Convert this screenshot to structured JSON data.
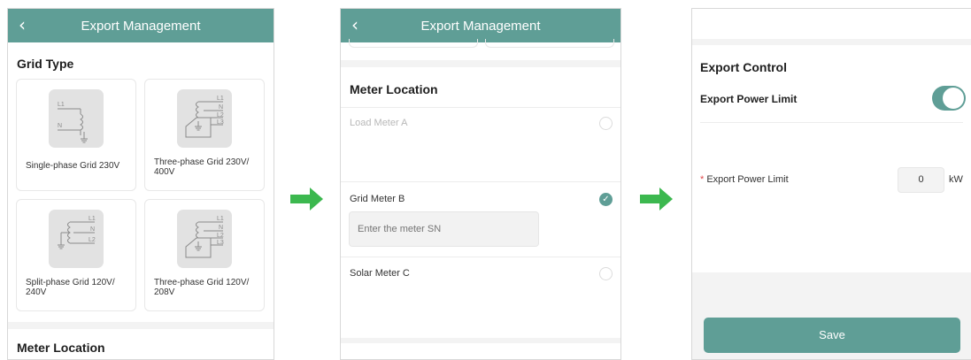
{
  "screen1": {
    "back_icon": "chevron-left-icon",
    "title": "Export Management",
    "grid_type_title": "Grid Type",
    "options": [
      {
        "label": "Single-phase Grid 230V",
        "wires": [
          "L1",
          "N"
        ]
      },
      {
        "label": "Three-phase Grid 230V/ 400V",
        "wires": [
          "L1",
          "N",
          "L2",
          "L3"
        ]
      },
      {
        "label": "Split-phase Grid 120V/ 240V",
        "wires": [
          "L1",
          "N",
          "L2"
        ]
      },
      {
        "label": "Three-phase Grid 120V/ 208V",
        "wires": [
          "L1",
          "N",
          "L2",
          "L3"
        ]
      }
    ],
    "meter_location_title": "Meter Location"
  },
  "screen2": {
    "back_icon": "chevron-left-icon",
    "title": "Export Management",
    "meter_location_title": "Meter Location",
    "meters": [
      {
        "label": "Load Meter A",
        "selected": false
      },
      {
        "label": "Grid Meter B",
        "selected": true
      },
      {
        "label": "Solar Meter C",
        "selected": false
      }
    ],
    "sn_placeholder": "Enter the meter SN",
    "check_glyph": "✓"
  },
  "screen3": {
    "export_control_title": "Export Control",
    "toggle_label": "Export Power Limit",
    "toggle_on": true,
    "required_mark": "*",
    "limit_label": "Export Power Limit",
    "limit_value": "0",
    "limit_unit": "kW",
    "save_label": "Save"
  },
  "colors": {
    "accent": "#5f9e96",
    "arrow": "#3cb84f",
    "required": "#e0484a"
  },
  "flow_arrow_icon": "arrow-right-icon"
}
